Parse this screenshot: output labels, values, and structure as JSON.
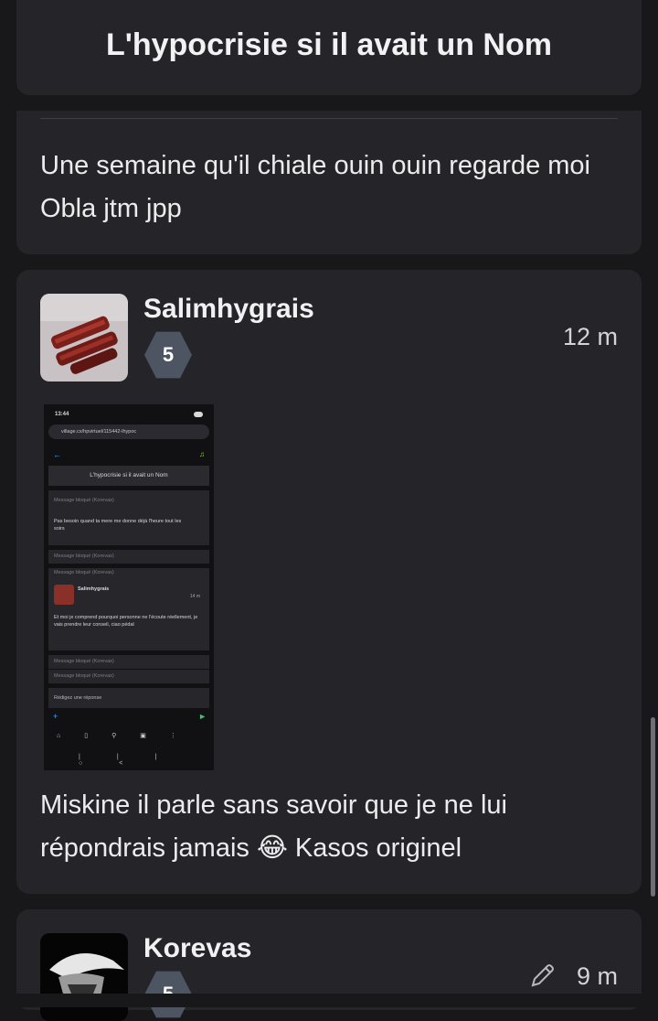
{
  "thread": {
    "title": "L'hypocrisie si il avait un Nom"
  },
  "posts": [
    {
      "text": "Une semaine qu'il chiale ouin ouin regarde moi Obla jtm jpp"
    },
    {
      "username": "Salimhygrais",
      "level": "5",
      "time": "12 m",
      "text": "Miskine il parle sans savoir que je ne lui répondrais jamais 😂 Kasos originel",
      "screenshot": {
        "status_time": "13:44",
        "url": "village.cx/hpvirtuel/115442-lhypoc",
        "title": "L'hypocrisie si il avait un Nom",
        "blocked_1": "Message bloqué (Korevas)",
        "quote_text": "Pas besoin quand ta mere me donne déjà l'heure tout les soirs",
        "blocked_2": "Message bloqué (Korevas)",
        "blocked_3": "Message bloqué (Korevas)",
        "inner_user": "Salimhygrais",
        "inner_time": "14 m",
        "inner_text": "Et moi je comprend pourquoi personne ne l'écoute réellement, je vais prendre leur conseil, ciao pédal",
        "blocked_4": "Message bloqué (Korevas)",
        "blocked_5": "Message bloqué (Korevas)",
        "reply_placeholder": "Rédigez une réponse"
      }
    },
    {
      "username": "Korevas",
      "level": "5",
      "time": "9 m"
    }
  ],
  "colors": {
    "background": "#18181b",
    "card": "#252529",
    "badge": "#4d5563",
    "accent_green": "#2ecc71"
  },
  "icons": [
    "edit-pencil-icon",
    "avatar-image",
    "scrollbar"
  ]
}
